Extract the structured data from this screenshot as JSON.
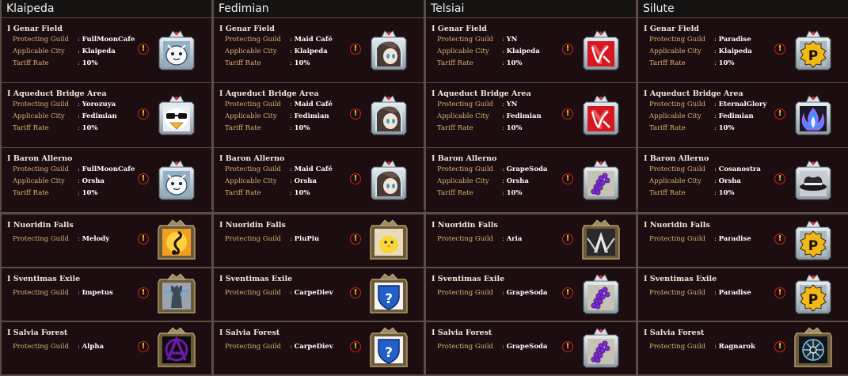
{
  "regions": [
    {
      "name": "Klaipeda",
      "territories": [
        {
          "zone": "I Genar Field",
          "guild": "FullMoonCafe",
          "city": "Klaipeda",
          "tariff": "10%",
          "emblem": "white-ghost-emblem"
        },
        {
          "zone": "I Aqueduct Bridge Area",
          "guild": "Yorozuya",
          "city": "Fedimian",
          "tariff": "10%",
          "emblem": "sunglasses-penguin-emblem"
        },
        {
          "zone": "I Baron Allerno",
          "guild": "FullMoonCafe",
          "city": "Orsha",
          "tariff": "10%",
          "emblem": "white-ghost-emblem"
        }
      ],
      "outposts": [
        {
          "zone": "I Nuoridin Falls",
          "guild": "Melody",
          "emblem": "music-note-emblem"
        },
        {
          "zone": "I Sventimas Exile",
          "guild": "Impetus",
          "emblem": "tower-emblem"
        },
        {
          "zone": "I Salvia Forest",
          "guild": "Alpha",
          "emblem": "anarchy-emblem"
        }
      ]
    },
    {
      "name": "Fedimian",
      "territories": [
        {
          "zone": "I Genar Field",
          "guild": "Maid Café",
          "city": "Klaipeda",
          "tariff": "10%",
          "emblem": "anime-girl-emblem"
        },
        {
          "zone": "I Aqueduct Bridge Area",
          "guild": "Maid Café",
          "city": "Fedimian",
          "tariff": "10%",
          "emblem": "anime-girl-emblem"
        },
        {
          "zone": "I Baron Allerno",
          "guild": "Maid Café",
          "city": "Orsha",
          "tariff": "10%",
          "emblem": "anime-girl-emblem"
        }
      ],
      "outposts": [
        {
          "zone": "I Nuoridin Falls",
          "guild": "PiuPiu",
          "emblem": "chick-emblem"
        },
        {
          "zone": "I Sventimas Exile",
          "guild": "CarpeDiev",
          "emblem": "question-shield-emblem"
        },
        {
          "zone": "I Salvia Forest",
          "guild": "CarpeDiev",
          "emblem": "question-shield-emblem"
        }
      ]
    },
    {
      "name": "Telsiai",
      "territories": [
        {
          "zone": "I Genar Field",
          "guild": "YN",
          "city": "Klaipeda",
          "tariff": "10%",
          "emblem": "yn-logo-emblem"
        },
        {
          "zone": "I Aqueduct Bridge Area",
          "guild": "YN",
          "city": "Fedimian",
          "tariff": "10%",
          "emblem": "yn-logo-emblem"
        },
        {
          "zone": "I Baron Allerno",
          "guild": "GrapeSoda",
          "city": "Orsha",
          "tariff": "10%",
          "emblem": "grape-emblem"
        }
      ],
      "outposts": [
        {
          "zone": "I Nuoridin Falls",
          "guild": "Aria",
          "emblem": "winged-a-emblem"
        },
        {
          "zone": "I Sventimas Exile",
          "guild": "GrapeSoda",
          "emblem": "grape-emblem"
        },
        {
          "zone": "I Salvia Forest",
          "guild": "GrapeSoda",
          "emblem": "grape-emblem"
        }
      ]
    },
    {
      "name": "Silute",
      "territories": [
        {
          "zone": "I Genar Field",
          "guild": "Paradise",
          "city": "Klaipeda",
          "tariff": "10%",
          "emblem": "p-badge-emblem"
        },
        {
          "zone": "I Aqueduct Bridge Area",
          "guild": "EternalGlory",
          "city": "Fedimian",
          "tariff": "10%",
          "emblem": "blue-flame-emblem"
        },
        {
          "zone": "I Baron Allerno",
          "guild": "Cosanostra",
          "city": "Orsha",
          "tariff": "10%",
          "emblem": "fedora-hat-emblem"
        }
      ],
      "outposts": [
        {
          "zone": "I Nuoridin Falls",
          "guild": "Paradise",
          "emblem": "p-badge-emblem"
        },
        {
          "zone": "I Sventimas Exile",
          "guild": "Paradise",
          "emblem": "p-badge-emblem"
        },
        {
          "zone": "I Salvia Forest",
          "guild": "Ragnarok",
          "emblem": "rune-wheel-emblem"
        }
      ]
    }
  ],
  "labels": {
    "protecting_guild": "Protecting Guild",
    "applicable_city": "Applicable City",
    "tariff_rate": "Tariff Rate",
    "colon": ":",
    "warning": "!"
  },
  "colors": {
    "card_background": "#1c0e10",
    "header_background": "#151212",
    "key_text": "#d8b070",
    "warning_ring": "#d02020",
    "warning_mark": "#f0d020"
  }
}
